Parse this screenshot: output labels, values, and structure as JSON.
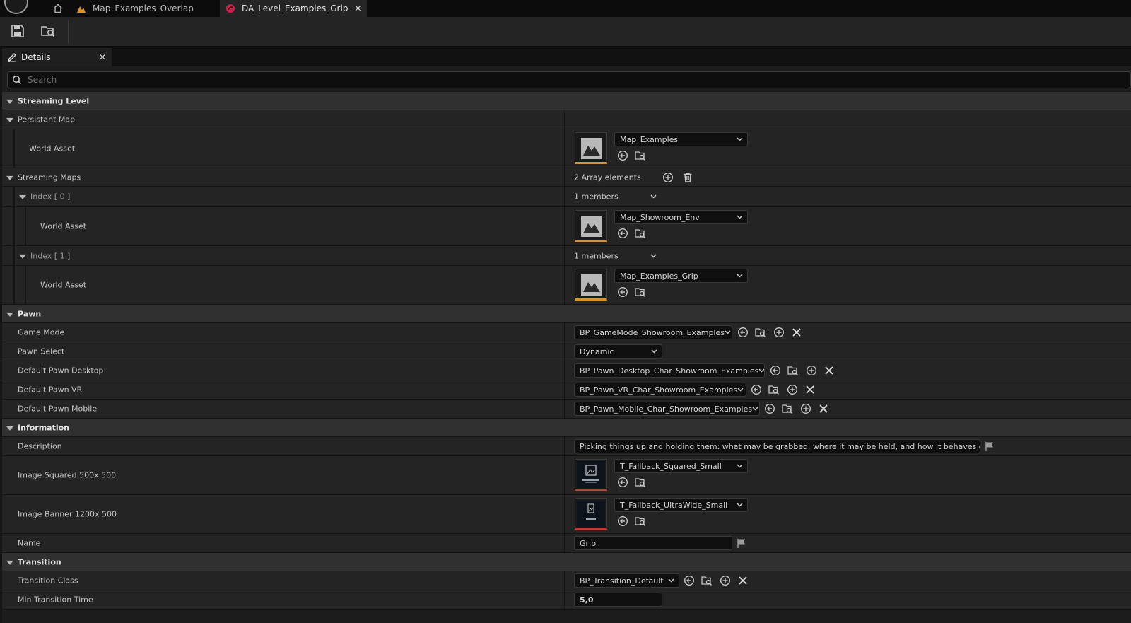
{
  "tabs": [
    {
      "label": "Map_Examples_Overlap",
      "icon": "level-icon"
    },
    {
      "label": "DA_Level_Examples_Grip",
      "icon": "data-asset-icon",
      "active": true
    }
  ],
  "details_tab": {
    "label": "Details"
  },
  "search": {
    "placeholder": "Search"
  },
  "streaming_level": {
    "label": "Streaming Level",
    "persistant_map": {
      "label": "Persistant Map",
      "world_asset": {
        "label": "World Asset",
        "value": "Map_Examples"
      }
    },
    "streaming_maps": {
      "label": "Streaming Maps",
      "count": "2 Array elements",
      "items": [
        {
          "label": "Index [ 0 ]",
          "members": "1 members",
          "world_asset_label": "World Asset",
          "value": "Map_Showroom_Env"
        },
        {
          "label": "Index [ 1 ]",
          "members": "1 members",
          "world_asset_label": "World Asset",
          "value": "Map_Examples_Grip"
        }
      ]
    }
  },
  "pawn": {
    "label": "Pawn",
    "game_mode": {
      "label": "Game Mode",
      "value": "BP_GameMode_Showroom_Examples"
    },
    "pawn_select": {
      "label": "Pawn Select",
      "value": "Dynamic"
    },
    "desktop": {
      "label": "Default Pawn Desktop",
      "value": "BP_Pawn_Desktop_Char_Showroom_Examples"
    },
    "vr": {
      "label": "Default Pawn VR",
      "value": "BP_Pawn_VR_Char_Showroom_Examples"
    },
    "mobile": {
      "label": "Default Pawn Mobile",
      "value": "BP_Pawn_Mobile_Char_Showroom_Examples"
    }
  },
  "information": {
    "label": "Information",
    "description": {
      "label": "Description",
      "value": "Picking things up and holding them: what may be grabbed, where it may be held, and how it behaves once it is b"
    },
    "image_squared": {
      "label": "Image Squared 500x 500",
      "value": "T_Fallback_Squared_Small"
    },
    "image_banner": {
      "label": "Image Banner 1200x 500",
      "value": "T_Fallback_UltraWide_Small"
    },
    "name": {
      "label": "Name",
      "value": "Grip"
    }
  },
  "transition": {
    "label": "Transition",
    "class": {
      "label": "Transition Class",
      "value": "BP_Transition_Default"
    },
    "min_time": {
      "label": "Min Transition Time",
      "value": "5,0"
    }
  },
  "colors": {
    "asset_world": "#e0921f",
    "asset_texture": "#c53838",
    "tab_grip_icon": "#d0204a",
    "tab_overlap_icon": "#e0921f"
  }
}
